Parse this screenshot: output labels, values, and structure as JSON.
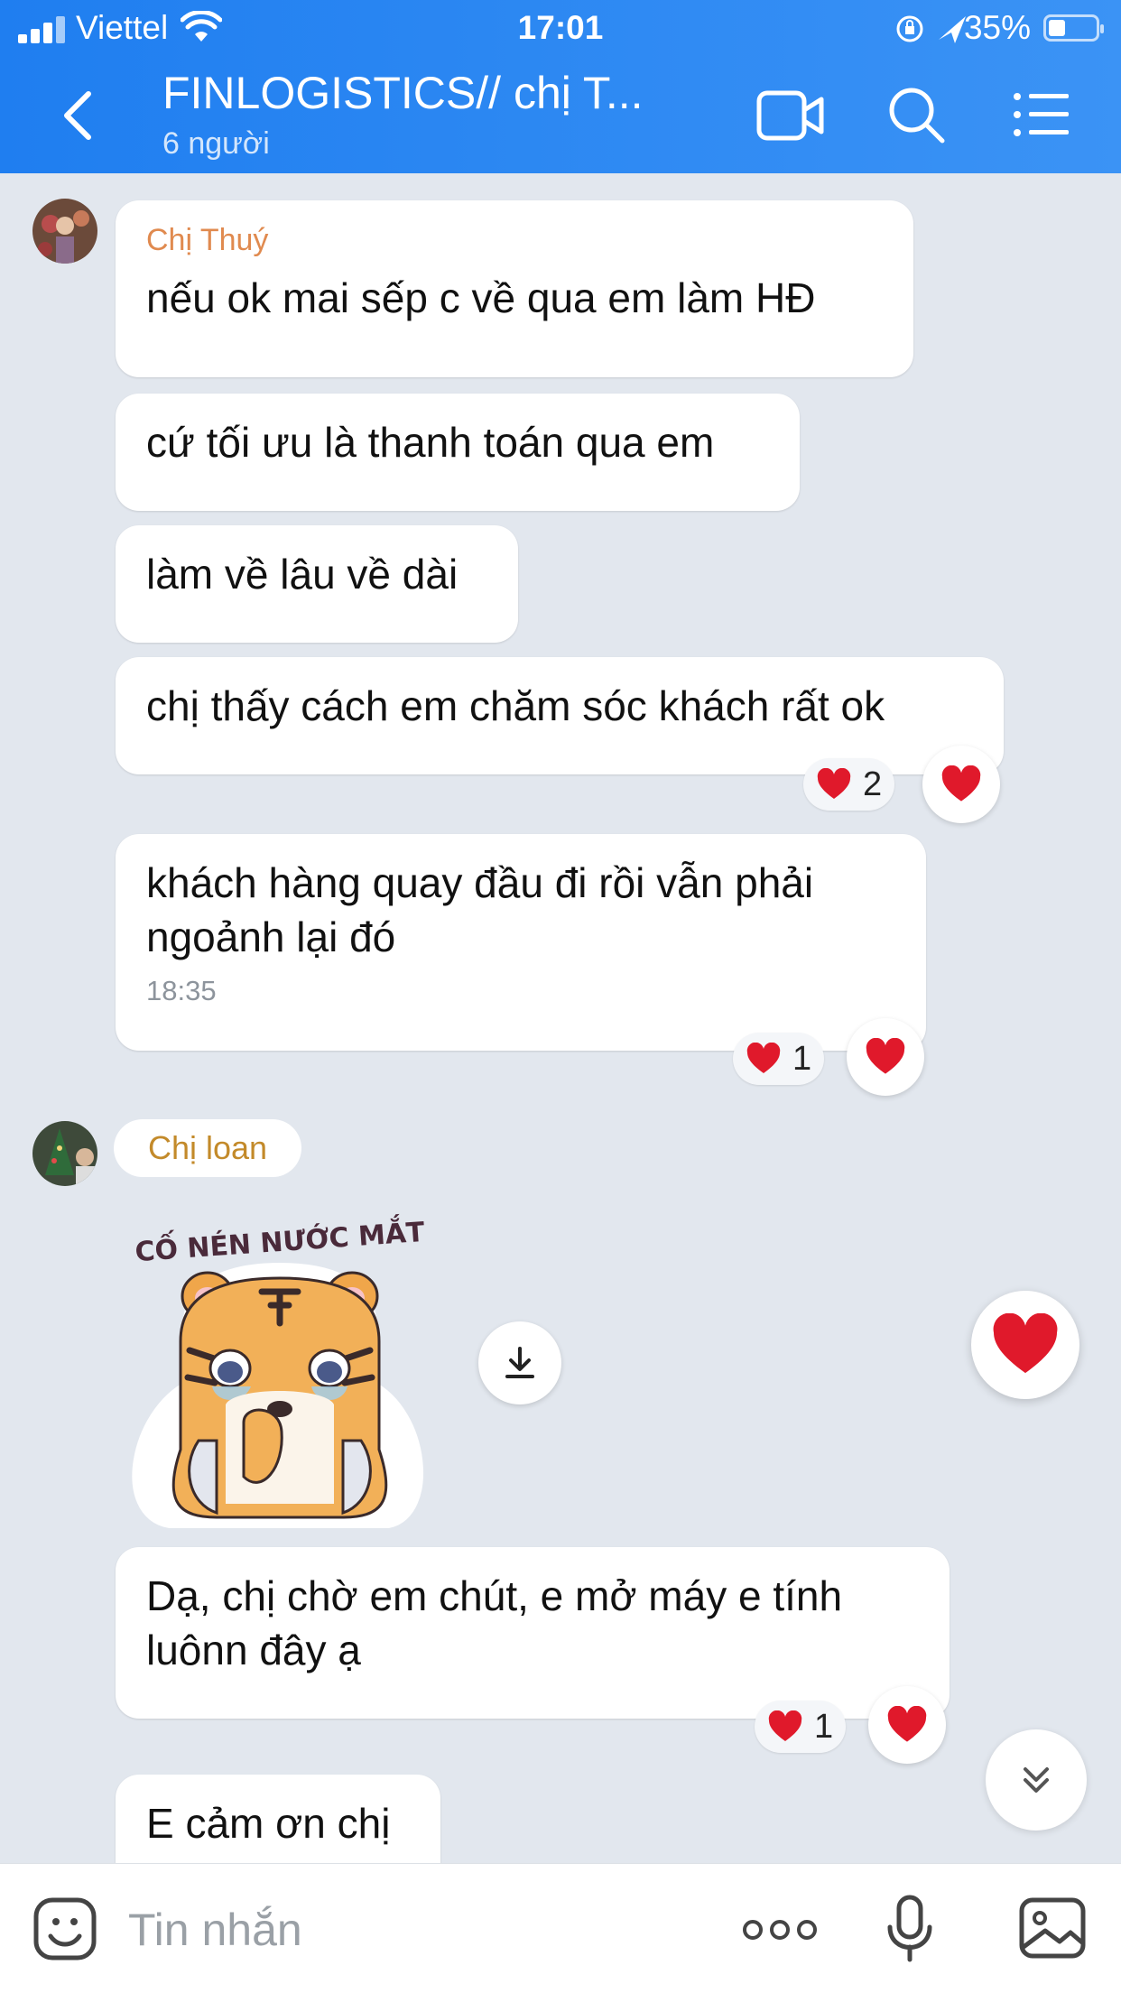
{
  "status_bar": {
    "carrier": "Viettel",
    "time": "17:01",
    "battery": "35%"
  },
  "header": {
    "title": "FINLOGISTICS// chị T...",
    "subtitle": "6 người"
  },
  "messages": {
    "m1": {
      "sender": "Chị  Thuý",
      "text": "nếu ok mai sếp c về qua em làm HĐ"
    },
    "m2": {
      "text": "cứ tối ưu là thanh toán qua em"
    },
    "m3": {
      "text": "làm về lâu về dài"
    },
    "m4": {
      "text": "chị thấy cách em chăm sóc khách rất ok",
      "reaction_count": "2"
    },
    "m5": {
      "text": "khách hàng quay đầu đi rồi vẫn phải ngoảnh lại đó",
      "time": "18:35",
      "reaction_count": "1"
    },
    "m6": {
      "sender": "Chị loan",
      "sticker_text": "CỐ NÉN NƯỚC MẮT"
    },
    "m7": {
      "text": "Dạ, chị chờ em chút, e mở máy e tính luônn đây ạ",
      "reaction_count": "1"
    },
    "m8": {
      "text": "E cảm ơn chị"
    }
  },
  "input": {
    "placeholder": "Tin nhắn"
  },
  "colors": {
    "header": "#2586f2",
    "sender_thuy": "#e08a4f",
    "sender_loan": "#c38a2a",
    "heart": "#e0192b"
  }
}
